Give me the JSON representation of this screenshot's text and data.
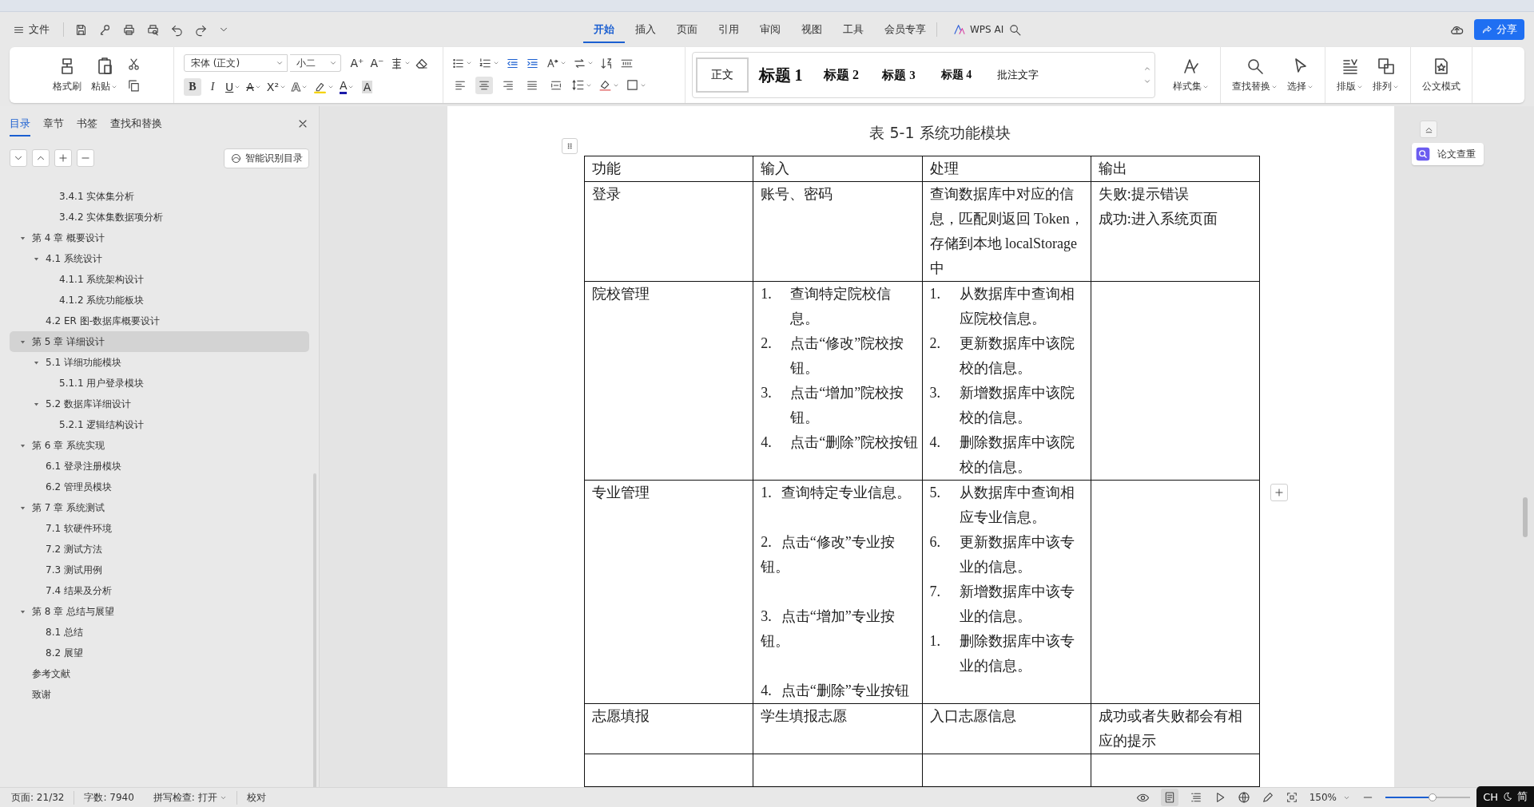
{
  "menu": {
    "file": "文件",
    "tabs": [
      {
        "label": "开始",
        "selected": true
      },
      {
        "label": "插入",
        "selected": false
      },
      {
        "label": "页面",
        "selected": false
      },
      {
        "label": "引用",
        "selected": false
      },
      {
        "label": "审阅",
        "selected": false
      },
      {
        "label": "视图",
        "selected": false
      },
      {
        "label": "工具",
        "selected": false
      },
      {
        "label": "会员专享",
        "selected": false
      }
    ],
    "ai": "WPS AI",
    "share": "分享"
  },
  "ribbon": {
    "clipboard": [
      {
        "label": "格式刷",
        "dropdown": false
      },
      {
        "label": "粘贴",
        "dropdown": true
      }
    ],
    "font": {
      "name": "宋体 (正文)",
      "size": "小二",
      "sizers": [
        "A⁺",
        "A⁻"
      ],
      "formats": [
        {
          "kind": "bold",
          "glyph": "B",
          "on": true
        },
        {
          "kind": "italic",
          "glyph": "I",
          "on": false
        },
        {
          "kind": "underline",
          "glyph": "U",
          "on": false
        },
        {
          "kind": "strike",
          "glyph": "A",
          "on": false
        },
        {
          "kind": "superscript",
          "glyph": "X²",
          "on": false
        },
        {
          "kind": "effect",
          "glyph": "A",
          "on": false
        },
        {
          "kind": "highlight",
          "on": false
        },
        {
          "kind": "color",
          "glyph": "A",
          "on": false
        },
        {
          "kind": "shade",
          "glyph": "A",
          "on": false
        }
      ]
    },
    "alignment": [
      {
        "kind": "left",
        "selected": false
      },
      {
        "kind": "center",
        "selected": true
      },
      {
        "kind": "right",
        "selected": false
      },
      {
        "kind": "justify",
        "selected": false
      },
      {
        "kind": "distributed",
        "selected": false
      }
    ],
    "styles": [
      {
        "label": "正文",
        "kind": "normal",
        "selected": true
      },
      {
        "label": "标题 1",
        "kind": "h1",
        "selected": false
      },
      {
        "label": "标题 2",
        "kind": "h2",
        "selected": false
      },
      {
        "label": "标题 3",
        "kind": "h3",
        "selected": false
      },
      {
        "label": "标题 4",
        "kind": "h4",
        "selected": false
      },
      {
        "label": "批注文字",
        "kind": "note",
        "selected": false
      }
    ],
    "tools": [
      {
        "kind": "styles",
        "label": "样式集",
        "dropdown": true
      },
      {
        "kind": "find",
        "label": "查找替换",
        "dropdown": true
      },
      {
        "kind": "select",
        "label": "选择",
        "dropdown": true
      },
      {
        "kind": "layout",
        "label": "排版",
        "dropdown": true
      },
      {
        "kind": "arrange",
        "label": "排列",
        "dropdown": true
      },
      {
        "kind": "official",
        "label": "公文模式",
        "dropdown": false
      }
    ]
  },
  "sidebar": {
    "tabs": [
      {
        "label": "目录",
        "selected": true
      },
      {
        "label": "章节",
        "selected": false
      },
      {
        "label": "书签",
        "selected": false
      },
      {
        "label": "查找和替换",
        "selected": false
      }
    ],
    "smart_toc": "智能识别目录",
    "toc": [
      {
        "children": [
          {
            "children": [
              {
                "label": "3.4.1  实体集分析",
                "selected": false
              },
              {
                "label": "3.4.2  实体集数据项分析",
                "selected": false
              }
            ]
          }
        ]
      },
      {
        "label": "第 4 章  概要设计",
        "selected": false,
        "expanded": true,
        "children": [
          {
            "label": "4.1  系统设计",
            "selected": false,
            "expanded": true,
            "children": [
              {
                "label": "4.1.1  系统架构设计",
                "selected": false
              },
              {
                "label": "4.1.2  系统功能板块",
                "selected": false
              }
            ]
          },
          {
            "label": "4.2 ER 图-数据库概要设计",
            "selected": false
          }
        ]
      },
      {
        "label": "第 5 章  详细设计",
        "selected": true,
        "expanded": true,
        "children": [
          {
            "label": "5.1  详细功能模块",
            "selected": false,
            "expanded": true,
            "children": [
              {
                "label": "5.1.1  用户登录模块",
                "selected": false
              }
            ]
          },
          {
            "label": "5.2  数据库详细设计",
            "selected": false,
            "expanded": true,
            "children": [
              {
                "label": "5.2.1  逻辑结构设计",
                "selected": false
              }
            ]
          }
        ]
      },
      {
        "label": "第 6 章  系统实现",
        "selected": false,
        "expanded": true,
        "children": [
          {
            "label": "6.1  登录注册模块",
            "selected": false
          },
          {
            "label": "6.2  管理员模块",
            "selected": false
          }
        ]
      },
      {
        "label": "第 7 章  系统测试",
        "selected": false,
        "expanded": true,
        "children": [
          {
            "label": "7.1  软硬件环境",
            "selected": false
          },
          {
            "label": "7.2  测试方法",
            "selected": false
          },
          {
            "label": "7.3  测试用例",
            "selected": false
          },
          {
            "label": "7.4  结果及分析",
            "selected": false
          }
        ]
      },
      {
        "label": "第 8 章  总结与展望",
        "selected": false,
        "expanded": true,
        "children": [
          {
            "label": "8.1  总结",
            "selected": false
          },
          {
            "label": "8.2  展望",
            "selected": false
          }
        ]
      },
      {
        "label": "参考文献",
        "selected": false
      },
      {
        "label": "致谢",
        "selected": false
      }
    ]
  },
  "document": {
    "caption": "表 5-1  系统功能模块",
    "table": {
      "columns": [
        "功能",
        "输入",
        "处理",
        "输出"
      ],
      "rows": [
        {
          "cells": [
            {
              "paragraphs": [
                {
                  "kind": "plain",
                  "text": "登录"
                }
              ]
            },
            {
              "paragraphs": [
                {
                  "kind": "plain",
                  "text": "账号、密码"
                }
              ]
            },
            {
              "paragraphs": [
                {
                  "kind": "plain",
                  "text": "查询数据库中对应的信息，匹配则返回 Token，存储到本地 localStorage 中"
                }
              ]
            },
            {
              "paragraphs": [
                {
                  "kind": "plain",
                  "text": "失败:提示错误"
                },
                {
                  "kind": "plain",
                  "text": "成功:进入系统页面"
                }
              ]
            }
          ]
        },
        {
          "cells": [
            {
              "paragraphs": [
                {
                  "kind": "plain",
                  "text": "院校管理"
                }
              ]
            },
            {
              "paragraphs": [
                {
                  "kind": "hanging",
                  "marker": "1.",
                  "text": "查询特定院校信息。"
                },
                {
                  "kind": "hanging",
                  "marker": "2.",
                  "text": "点击“修改”院校按钮。"
                },
                {
                  "kind": "hanging",
                  "marker": "3.",
                  "text": "点击“增加”院校按钮。"
                },
                {
                  "kind": "hanging",
                  "marker": "4.",
                  "text": "点击“删除”院校按钮"
                }
              ]
            },
            {
              "paragraphs": [
                {
                  "kind": "hanging",
                  "marker": "1.",
                  "text": "从数据库中查询相应院校信息。"
                },
                {
                  "kind": "hanging",
                  "marker": "2.",
                  "text": "更新数据库中该院校的信息。"
                },
                {
                  "kind": "hanging",
                  "marker": "3.",
                  "text": "新增数据库中该院校的信息。"
                },
                {
                  "kind": "hanging",
                  "marker": "4.",
                  "text": "删除数据库中该院校的信息。"
                }
              ]
            },
            ""
          ]
        },
        {
          "cells": [
            {
              "paragraphs": [
                {
                  "kind": "plain",
                  "text": "专业管理"
                }
              ]
            },
            {
              "paragraphs": [
                {
                  "kind": "inline",
                  "marker": "1.",
                  "text": "查询特定专业信息。"
                },
                {
                  "kind": "inline",
                  "marker": "2.",
                  "text": "点击“修改”专业按钮。"
                },
                {
                  "kind": "inline",
                  "marker": "3.",
                  "text": "点击“增加”专业按钮。"
                },
                {
                  "kind": "inline",
                  "marker": "4.",
                  "text": "点击“删除”专业按钮"
                }
              ]
            },
            {
              "paragraphs": [
                {
                  "kind": "hanging",
                  "marker": "5.",
                  "text": "从数据库中查询相应专业信息。"
                },
                {
                  "kind": "hanging",
                  "marker": "6.",
                  "text": "更新数据库中该专业的信息。"
                },
                {
                  "kind": "hanging",
                  "marker": "7.",
                  "text": "新增数据库中该专业的信息。"
                },
                {
                  "kind": "hanging",
                  "marker": "1.",
                  "text": "删除数据库中该专业的信息。"
                }
              ]
            },
            ""
          ]
        },
        {
          "cells": [
            {
              "paragraphs": [
                {
                  "kind": "plain",
                  "text": "志愿填报"
                }
              ]
            },
            {
              "paragraphs": [
                {
                  "kind": "plain",
                  "text": "学生填报志愿"
                }
              ]
            },
            {
              "paragraphs": [
                {
                  "kind": "plain",
                  "text": "入口志愿信息"
                }
              ]
            },
            {
              "paragraphs": [
                {
                  "kind": "plain",
                  "text": "成功或者失败都会有相应的提示"
                }
              ]
            }
          ]
        }
      ]
    }
  },
  "review_panel": {
    "check_button": "论文查重"
  },
  "status_bar": {
    "page": "页面: 21/32",
    "words": "字数: 7940",
    "spell": "拼写检查: 打开",
    "proofread": "校对",
    "zoom": "150%",
    "zoom_slider": {
      "level": 0.56
    }
  },
  "ime": {
    "language": "CH",
    "mode": "简"
  }
}
